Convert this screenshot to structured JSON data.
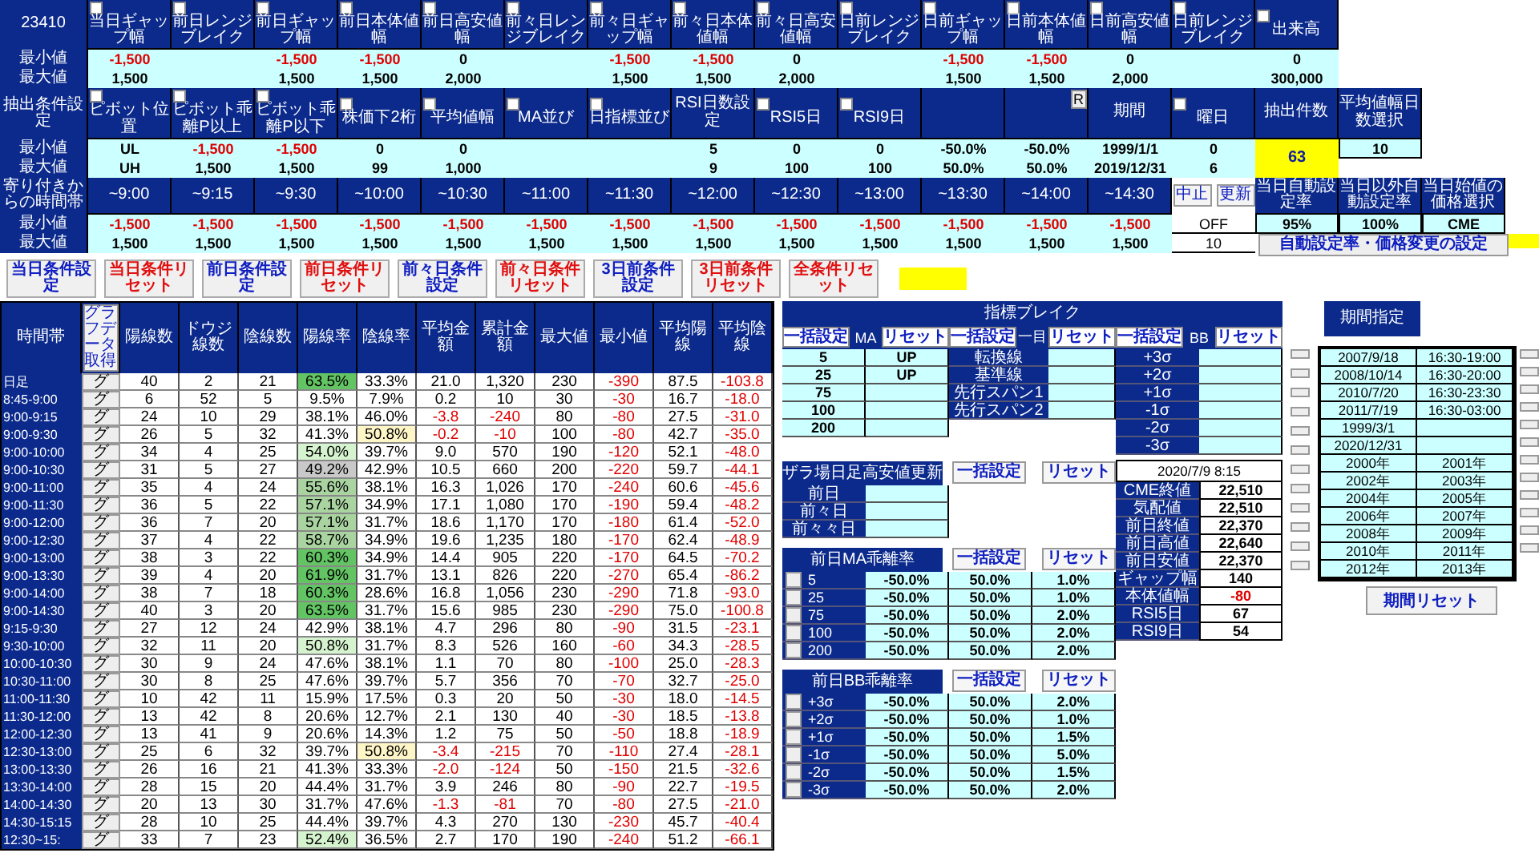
{
  "condition_grid": {
    "corner": "23410",
    "min_label": "最小値",
    "max_label": "最大値",
    "headers": [
      {
        "label": "当日ギャップ幅",
        "checked": false,
        "min": "-1,500",
        "max": "1,500"
      },
      {
        "label": "前日レンジブレイク",
        "checked": false
      },
      {
        "label": "前日ギャップ幅",
        "checked": false,
        "min": "-1,500",
        "max": "1,500"
      },
      {
        "label": "前日本体値幅",
        "checked": false,
        "min": "-1,500",
        "max": "1,500"
      },
      {
        "label": "前日高安値幅",
        "checked": false,
        "min": "0",
        "max": "2,000"
      },
      {
        "label": "前々日レンジブレイク",
        "checked": false
      },
      {
        "label": "前々日ギャップ幅",
        "checked": false,
        "min": "-1,500",
        "max": "1,500"
      },
      {
        "label": "前々日本体値幅",
        "checked": false,
        "min": "-1,500",
        "max": "1,500"
      },
      {
        "label": "前々日高安値幅",
        "checked": false,
        "min": "0",
        "max": "2,000"
      },
      {
        "label": "日前レンジブレイク",
        "checked": false
      },
      {
        "label": "日前ギャップ幅",
        "checked": false,
        "min": "-1,500",
        "max": "1,500"
      },
      {
        "label": "日前本体値幅",
        "checked": false,
        "min": "-1,500",
        "max": "1,500"
      },
      {
        "label": "日前高安値幅",
        "checked": false,
        "min": "0",
        "max": "2,000"
      },
      {
        "label": "日前レンジブレイク",
        "checked": false
      },
      {
        "label": "出来高",
        "checked": false,
        "min": "0",
        "max": "300,000"
      }
    ]
  },
  "extract": {
    "title": "抽出条件設定",
    "min_label": "最小値",
    "max_label": "最大値",
    "headers": [
      {
        "kind": "label",
        "label": "ピボット位置",
        "checked": false,
        "min": "UL",
        "max": "UH"
      },
      {
        "kind": "label",
        "label": "ピボット乖離P以上",
        "checked": false,
        "min": "-1,500",
        "max": "1,500"
      },
      {
        "kind": "label",
        "label": "ピボット乖離P以下",
        "checked": false,
        "min": "-1,500",
        "max": "1,500"
      },
      {
        "kind": "label",
        "label": "株価下2桁",
        "checked": false,
        "min": "0",
        "max": "99"
      },
      {
        "kind": "label",
        "label": "平均値幅",
        "checked": false,
        "min": "0",
        "max": "1,000"
      },
      {
        "kind": "label",
        "label": "MA並び",
        "checked": false
      },
      {
        "kind": "label",
        "label": "日指標並び",
        "checked": false
      },
      {
        "kind": "label",
        "label": "RSI日数設定",
        "min": "5",
        "max": "9"
      },
      {
        "kind": "label",
        "label": "RSI5日",
        "checked": false,
        "min": "0",
        "max": "100"
      },
      {
        "kind": "label",
        "label": "RSI9日",
        "checked": false,
        "min": "0",
        "max": "100"
      },
      {
        "kind": "blank",
        "min": "-50.0%",
        "max": "50.0%"
      },
      {
        "kind": "button",
        "button": "R",
        "min": "-50.0%",
        "max": "50.0%"
      },
      {
        "kind": "label",
        "label": "期間",
        "min": "1999/1/1",
        "max": "2019/12/31"
      },
      {
        "kind": "label",
        "label": "曜日",
        "checked": false,
        "min": "0",
        "max": "6"
      },
      {
        "kind": "label",
        "label": "抽出件数"
      },
      {
        "kind": "label",
        "label": "平均値幅日数選択"
      }
    ],
    "count": "63",
    "avg_days": "10"
  },
  "time_block": {
    "title": "寄り付きからの時間帯",
    "min_label": "最小値",
    "max_label": "最大値",
    "headers": [
      "~9:00",
      "~9:15",
      "~9:30",
      "~10:00",
      "~10:30",
      "~11:00",
      "~11:30",
      "~12:00",
      "~12:30",
      "~13:00",
      "~13:30",
      "~14:00",
      "~14:30"
    ],
    "min": [
      "-1,500",
      "-1,500",
      "-1,500",
      "-1,500",
      "-1,500",
      "-1,500",
      "-1,500",
      "-1,500",
      "-1,500",
      "-1,500",
      "-1,500",
      "-1,500",
      "-1,500"
    ],
    "max": [
      "1,500",
      "1,500",
      "1,500",
      "1,500",
      "1,500",
      "1,500",
      "1,500",
      "1,500",
      "1,500",
      "1,500",
      "1,500",
      "1,500",
      "1,500"
    ],
    "stop_button": "中止",
    "update_button": "更新",
    "toggle": "OFF",
    "interval": "10",
    "settings": [
      {
        "label": "当日自動設定率",
        "value": "95%"
      },
      {
        "label": "当日以外自動設定率",
        "value": "100%"
      },
      {
        "label": "当日始値の価格選択",
        "value": "CME"
      }
    ],
    "settings_button": "自動設定率・価格変更の設定"
  },
  "condition_buttons": [
    {
      "label": "当日条件設定",
      "kind": "set"
    },
    {
      "label": "当日条件リセット",
      "kind": "reset"
    },
    {
      "label": "前日条件設定",
      "kind": "set"
    },
    {
      "label": "前日条件リセット",
      "kind": "reset"
    },
    {
      "label": "前々日条件設定",
      "kind": "set"
    },
    {
      "label": "前々日条件リセット",
      "kind": "reset"
    },
    {
      "label": "3日前条件設定",
      "kind": "set"
    },
    {
      "label": "3日前条件リセット",
      "kind": "reset"
    },
    {
      "label": "全条件リセット",
      "kind": "reset"
    }
  ],
  "main_table": {
    "row_header": "時間帯",
    "graph_button": "グラフデータ取得",
    "columns": [
      "陽線数",
      "ドウジ線数",
      "陰線数",
      "陽線率",
      "陰線率",
      "平均金額",
      "累計金額",
      "最大値",
      "最小値",
      "平均陽線",
      "平均陰線"
    ],
    "rows": [
      {
        "label": "日足",
        "button": "グ",
        "cells": [
          "40",
          "2",
          "21",
          {
            "text": "63.5%",
            "color": "#63c463"
          },
          "33.3%",
          "21.0",
          "1,320",
          "230",
          "-390",
          "87.5",
          "-103.8"
        ]
      },
      {
        "label": "8:45-9:00",
        "button": "グ",
        "cells": [
          "6",
          "52",
          "5",
          "9.5%",
          "7.9%",
          "0.2",
          "10",
          "30",
          "-30",
          "16.7",
          "-18.0"
        ]
      },
      {
        "label": "9:00-9:15",
        "button": "グ",
        "cells": [
          "24",
          "10",
          "29",
          "38.1%",
          "46.0%",
          "-3.8",
          "-240",
          "80",
          "-80",
          "27.5",
          "-31.0"
        ]
      },
      {
        "label": "9:00-9:30",
        "button": "グ",
        "cells": [
          "26",
          "5",
          "32",
          "41.3%",
          {
            "text": "50.8%",
            "color": "#fff6c8"
          },
          "-0.2",
          "-10",
          "100",
          "-80",
          "42.7",
          "-35.0"
        ]
      },
      {
        "label": "9:00-10:00",
        "button": "グ",
        "cells": [
          "34",
          "4",
          "25",
          {
            "text": "54.0%",
            "color": "#d6f3cf"
          },
          "39.7%",
          "9.0",
          "570",
          "190",
          "-120",
          "52.1",
          "-48.0"
        ]
      },
      {
        "label": "9:00-10:30",
        "button": "グ",
        "cells": [
          "31",
          "5",
          "27",
          {
            "text": "49.2%",
            "color": "#c9c9c9"
          },
          "42.9%",
          "10.5",
          "660",
          "200",
          "-220",
          "59.7",
          "-44.1"
        ]
      },
      {
        "label": "9:00-11:00",
        "button": "グ",
        "cells": [
          "35",
          "4",
          "24",
          {
            "text": "55.6%",
            "color": "#a9d4a0"
          },
          "38.1%",
          "16.3",
          "1,026",
          "170",
          "-240",
          "60.6",
          "-45.6"
        ]
      },
      {
        "label": "9:00-11:30",
        "button": "グ",
        "cells": [
          "36",
          "5",
          "22",
          {
            "text": "57.1%",
            "color": "#a9d4a0"
          },
          "34.9%",
          "17.1",
          "1,080",
          "170",
          "-190",
          "59.4",
          "-48.2"
        ]
      },
      {
        "label": "9:00-12:00",
        "button": "グ",
        "cells": [
          "36",
          "7",
          "20",
          {
            "text": "57.1%",
            "color": "#a9d4a0"
          },
          "31.7%",
          "18.6",
          "1,170",
          "170",
          "-180",
          "61.4",
          "-52.0"
        ]
      },
      {
        "label": "9:00-12:30",
        "button": "グ",
        "cells": [
          "37",
          "4",
          "22",
          {
            "text": "58.7%",
            "color": "#a9d4a0"
          },
          "34.9%",
          "19.6",
          "1,235",
          "180",
          "-170",
          "62.4",
          "-48.9"
        ]
      },
      {
        "label": "9:00-13:00",
        "button": "グ",
        "cells": [
          "38",
          "3",
          "22",
          {
            "text": "60.3%",
            "color": "#63c463"
          },
          "34.9%",
          "14.4",
          "905",
          "220",
          "-170",
          "64.5",
          "-70.2"
        ]
      },
      {
        "label": "9:00-13:30",
        "button": "グ",
        "cells": [
          "39",
          "4",
          "20",
          {
            "text": "61.9%",
            "color": "#63c463"
          },
          "31.7%",
          "13.1",
          "826",
          "220",
          "-270",
          "65.4",
          "-86.2"
        ]
      },
      {
        "label": "9:00-14:00",
        "button": "グ",
        "cells": [
          "38",
          "7",
          "18",
          {
            "text": "60.3%",
            "color": "#63c463"
          },
          "28.6%",
          "16.8",
          "1,056",
          "230",
          "-290",
          "71.8",
          "-93.0"
        ]
      },
      {
        "label": "9:00-14:30",
        "button": "グ",
        "cells": [
          "40",
          "3",
          "20",
          {
            "text": "63.5%",
            "color": "#63c463"
          },
          "31.7%",
          "15.6",
          "985",
          "230",
          "-290",
          "75.0",
          "-100.8"
        ]
      },
      {
        "label": "9:15-9:30",
        "button": "グ",
        "cells": [
          "27",
          "12",
          "24",
          "42.9%",
          "38.1%",
          "4.7",
          "296",
          "80",
          "-90",
          "31.5",
          "-23.1"
        ]
      },
      {
        "label": "9:30-10:00",
        "button": "グ",
        "cells": [
          "32",
          "11",
          "20",
          {
            "text": "50.8%",
            "color": "#d6f3cf"
          },
          "31.7%",
          "8.3",
          "526",
          "160",
          "-60",
          "34.3",
          "-28.5"
        ]
      },
      {
        "label": "10:00-10:30",
        "button": "グ",
        "cells": [
          "30",
          "9",
          "24",
          "47.6%",
          "38.1%",
          "1.1",
          "70",
          "80",
          "-100",
          "25.0",
          "-28.3"
        ]
      },
      {
        "label": "10:30-11:00",
        "button": "グ",
        "cells": [
          "30",
          "8",
          "25",
          "47.6%",
          "39.7%",
          "5.7",
          "356",
          "70",
          "-70",
          "32.7",
          "-25.0"
        ]
      },
      {
        "label": "11:00-11:30",
        "button": "グ",
        "cells": [
          "10",
          "42",
          "11",
          "15.9%",
          "17.5%",
          "0.3",
          "20",
          "50",
          "-30",
          "18.0",
          "-14.5"
        ]
      },
      {
        "label": "11:30-12:00",
        "button": "グ",
        "cells": [
          "13",
          "42",
          "8",
          "20.6%",
          "12.7%",
          "2.1",
          "130",
          "40",
          "-30",
          "18.5",
          "-13.8"
        ]
      },
      {
        "label": "12:00-12:30",
        "button": "グ",
        "cells": [
          "13",
          "41",
          "9",
          "20.6%",
          "14.3%",
          "1.2",
          "75",
          "50",
          "-50",
          "18.8",
          "-18.9"
        ]
      },
      {
        "label": "12:30-13:00",
        "button": "グ",
        "cells": [
          "25",
          "6",
          "32",
          "39.7%",
          {
            "text": "50.8%",
            "color": "#fff6c8"
          },
          "-3.4",
          "-215",
          "70",
          "-110",
          "27.4",
          "-28.1"
        ]
      },
      {
        "label": "13:00-13:30",
        "button": "グ",
        "cells": [
          "26",
          "16",
          "21",
          "41.3%",
          "33.3%",
          "-2.0",
          "-124",
          "50",
          "-150",
          "21.5",
          "-32.6"
        ]
      },
      {
        "label": "13:30-14:00",
        "button": "グ",
        "cells": [
          "28",
          "15",
          "20",
          "44.4%",
          "31.7%",
          "3.9",
          "246",
          "80",
          "-90",
          "22.7",
          "-19.5"
        ]
      },
      {
        "label": "14:00-14:30",
        "button": "グ",
        "cells": [
          "20",
          "13",
          "30",
          "31.7%",
          "47.6%",
          "-1.3",
          "-81",
          "70",
          "-80",
          "27.5",
          "-21.0"
        ]
      },
      {
        "label": "14:30-15:15",
        "button": "グ",
        "cells": [
          "28",
          "10",
          "25",
          "44.4%",
          "39.7%",
          "4.3",
          "270",
          "130",
          "-230",
          "45.7",
          "-40.4"
        ]
      },
      {
        "label": "12:30~15:",
        "button": "グ",
        "cells": [
          "33",
          "7",
          "23",
          {
            "text": "52.4%",
            "color": "#d6f3cf"
          },
          "36.5%",
          "2.7",
          "170",
          "190",
          "-240",
          "51.2",
          "-66.1"
        ]
      }
    ]
  },
  "indicator_break": {
    "title": "指標ブレイク",
    "groups": [
      {
        "label": "MA",
        "kind": "value",
        "set_button": "一括設定",
        "reset_button": "リセット",
        "rows": [
          {
            "name": "5",
            "value": "UP"
          },
          {
            "name": "25",
            "value": "UP"
          },
          {
            "name": "75"
          },
          {
            "name": "100"
          },
          {
            "name": "200"
          }
        ]
      },
      {
        "label": "一目",
        "kind": "label",
        "set_button": "一括設定",
        "reset_button": "リセット",
        "rows": [
          {
            "name": "転換線"
          },
          {
            "name": "基準線"
          },
          {
            "name": "先行スパン1"
          },
          {
            "name": "先行スパン2"
          }
        ]
      },
      {
        "label": "BB",
        "kind": "label",
        "set_button": "一括設定",
        "reset_button": "リセット",
        "rows": [
          {
            "name": "+3σ"
          },
          {
            "name": "+2σ"
          },
          {
            "name": "+1σ"
          },
          {
            "name": "-1σ"
          },
          {
            "name": "-2σ"
          },
          {
            "name": "-3σ"
          }
        ]
      }
    ]
  },
  "zaraba": {
    "title": "ザラ場日足高安値更新",
    "set_button": "一括設定",
    "reset_button": "リセット",
    "rows": [
      "前日",
      "前々日",
      "前々々日"
    ]
  },
  "ma_deviation": {
    "title": "前日MA乖離率",
    "set_button": "一括設定",
    "reset_button": "リセット",
    "rows": [
      {
        "name": "5",
        "checked": false,
        "min": "-50.0%",
        "max": "50.0%",
        "step": "1.0%"
      },
      {
        "name": "25",
        "checked": false,
        "min": "-50.0%",
        "max": "50.0%",
        "step": "1.0%"
      },
      {
        "name": "75",
        "checked": false,
        "min": "-50.0%",
        "max": "50.0%",
        "step": "2.0%"
      },
      {
        "name": "100",
        "checked": false,
        "min": "-50.0%",
        "max": "50.0%",
        "step": "2.0%"
      },
      {
        "name": "200",
        "checked": false,
        "min": "-50.0%",
        "max": "50.0%",
        "step": "2.0%"
      }
    ]
  },
  "bb_deviation": {
    "title": "前日BB乖離率",
    "set_button": "一括設定",
    "reset_button": "リセット",
    "rows": [
      {
        "name": "+3σ",
        "checked": false,
        "min": "-50.0%",
        "max": "50.0%",
        "step": "2.0%"
      },
      {
        "name": "+2σ",
        "checked": false,
        "min": "-50.0%",
        "max": "50.0%",
        "step": "1.0%"
      },
      {
        "name": "+1σ",
        "checked": false,
        "min": "-50.0%",
        "max": "50.0%",
        "step": "1.5%"
      },
      {
        "name": "-1σ",
        "checked": false,
        "min": "-50.0%",
        "max": "50.0%",
        "step": "5.0%"
      },
      {
        "name": "-2σ",
        "checked": false,
        "min": "-50.0%",
        "max": "50.0%",
        "step": "1.5%"
      },
      {
        "name": "-3σ",
        "checked": false,
        "min": "-50.0%",
        "max": "50.0%",
        "step": "2.0%"
      }
    ]
  },
  "market": {
    "timestamp": "2020/7/9 8:15",
    "rows": [
      {
        "label": "CME終値",
        "value": "22,510"
      },
      {
        "label": "気配値",
        "value": "22,510"
      },
      {
        "label": "前日終値",
        "value": "22,370"
      },
      {
        "label": "前日高値",
        "value": "22,640"
      },
      {
        "label": "前日安値",
        "value": "22,370"
      },
      {
        "label": "ギャップ幅",
        "value": "140"
      },
      {
        "label": "本体値幅",
        "value": "-80"
      },
      {
        "label": "RSI5日",
        "value": "67"
      },
      {
        "label": "RSI9日",
        "value": "54"
      }
    ]
  },
  "side_buttons": [
    {
      "pressed": false
    },
    {
      "pressed": false
    },
    {
      "pressed": false
    },
    {
      "pressed": false
    },
    {
      "pressed": false
    },
    {
      "pressed": false
    },
    {
      "pressed": false
    },
    {
      "pressed": false
    },
    {
      "pressed": false
    },
    {
      "pressed": false
    },
    {
      "pressed": false
    },
    {
      "pressed": false
    }
  ],
  "period": {
    "title": "期間指定",
    "reset_button": "期間リセット",
    "rows": [
      {
        "date": "2007/9/18",
        "time": "16:30-19:00"
      },
      {
        "date": "2008/10/14",
        "time": "16:30-20:00"
      },
      {
        "date": "2010/7/20",
        "time": "16:30-23:30"
      },
      {
        "date": "2011/7/19",
        "time": "16:30-03:00"
      },
      {
        "date": "1999/3/1"
      },
      {
        "date": "2020/12/31"
      },
      {
        "date": "2000年",
        "time": "2001年"
      },
      {
        "date": "2002年",
        "time": "2003年"
      },
      {
        "date": "2004年",
        "time": "2005年"
      },
      {
        "date": "2006年",
        "time": "2007年"
      },
      {
        "date": "2008年",
        "time": "2009年"
      },
      {
        "date": "2010年",
        "time": "2011年"
      },
      {
        "date": "2012年",
        "time": "2013年"
      }
    ],
    "row_buttons": [
      {
        "pressed": false
      },
      {
        "pressed": false
      },
      {
        "pressed": false
      },
      {
        "pressed": false
      },
      {
        "pressed": false
      },
      {
        "pressed": false
      },
      {
        "pressed": false
      },
      {
        "pressed": false
      },
      {
        "pressed": false
      },
      {
        "pressed": false
      },
      {
        "pressed": false
      },
      {
        "pressed": false
      }
    ]
  }
}
